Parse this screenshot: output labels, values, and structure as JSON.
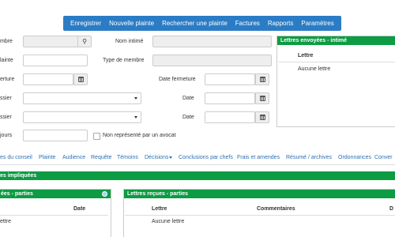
{
  "menu": {
    "items": [
      "Enregistrer",
      "Nouvelle plainte",
      "Rechercher une plainte",
      "Factures",
      "Rapports",
      "Paramètres"
    ]
  },
  "form": {
    "labels": {
      "membre": "mbre",
      "nom_intime": "Nom intimé",
      "plainte": "lainte",
      "type_membre": "Type de membre",
      "ouverture": "erture",
      "date_fermeture": "Date fermeture",
      "dossier1": "ssier",
      "date1": "Date",
      "dossier2": "ssier",
      "date2": "Date",
      "jours": "jours",
      "non_represente": "Non représenté par un avocat"
    }
  },
  "lettres_envoyees": {
    "title": "Lettres envoyées - intimé",
    "col_lettre": "Lettre",
    "empty": "Aucune lettre"
  },
  "tabs": [
    "es du conseil",
    "Plainte",
    "Audience",
    "Requête",
    "Témoins",
    "Décisions",
    "Conclusions par chefs",
    "Frais et amendes",
    "Résumé / archives",
    "Ordonnances",
    "Conver"
  ],
  "bar_impliquees": "es impliquées",
  "parties_panel": {
    "title": "ées - parties",
    "col_date": "Date",
    "row1": "ettre"
  },
  "lettres_recues": {
    "title": "Lettres reçues - parties",
    "col_lettre": "Lettre",
    "col_commentaires": "Commentaires",
    "col_extra": "D",
    "empty": "Aucune lettre"
  }
}
